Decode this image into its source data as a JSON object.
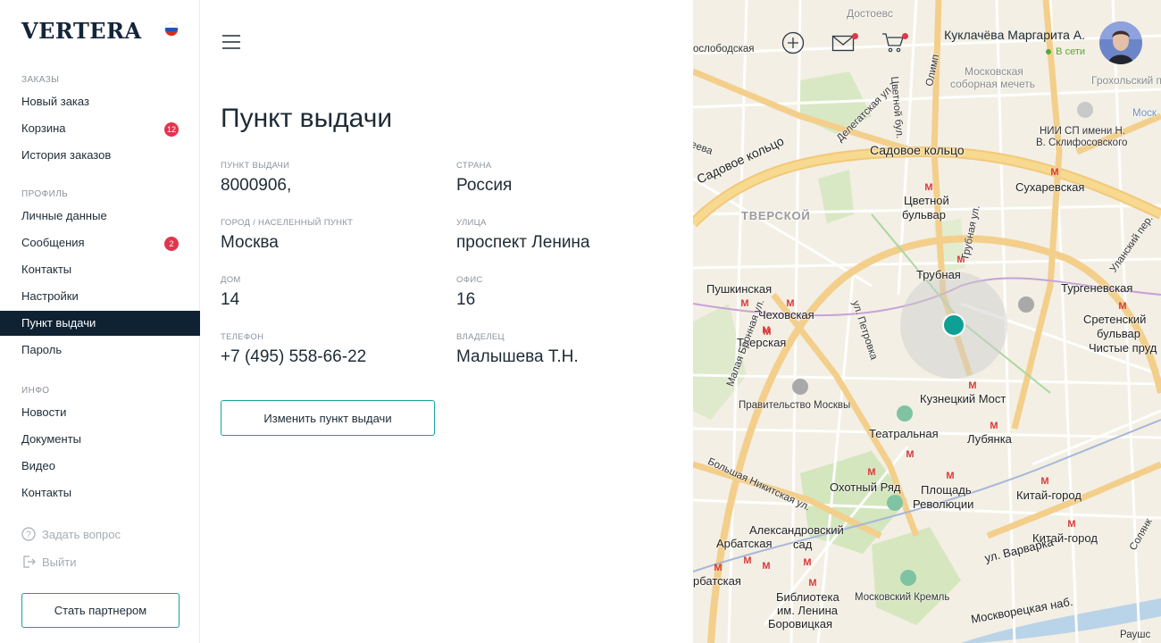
{
  "brand": {
    "logo": "VERTERA"
  },
  "sidebar": {
    "sections": [
      {
        "title": "ЗАКАЗЫ"
      },
      {
        "title": "ПРОФИЛЬ"
      },
      {
        "title": "ИНФО"
      }
    ],
    "items": [
      {
        "label": "Новый заказ"
      },
      {
        "label": "Корзина",
        "badge": "12"
      },
      {
        "label": "История заказов"
      },
      {
        "label": "Личные данные"
      },
      {
        "label": "Сообщения",
        "badge": "2"
      },
      {
        "label": "Контакты"
      },
      {
        "label": "Настройки"
      },
      {
        "label": "Пункт выдачи",
        "active": true
      },
      {
        "label": "Пароль"
      },
      {
        "label": "Новости"
      },
      {
        "label": "Документы"
      },
      {
        "label": "Видео"
      },
      {
        "label": "Контакты"
      }
    ],
    "ask_question": "Задать вопрос",
    "logout": "Выйти",
    "partner_button": "Стать партнером"
  },
  "main": {
    "title": "Пункт выдачи",
    "fields": [
      {
        "label": "ПУНКТ ВЫДАЧИ",
        "value": "8000906,"
      },
      {
        "label": "СТРАНА",
        "value": "Россия"
      },
      {
        "label": "ГОРОД / НАСЕЛЕННЫЙ ПУНКТ",
        "value": "Москва"
      },
      {
        "label": "УЛИЦА",
        "value": "проспект Ленина"
      },
      {
        "label": "ДОМ",
        "value": "14"
      },
      {
        "label": "ОФИС",
        "value": "16"
      },
      {
        "label": "ТЕЛЕФОН",
        "value": "+7 (495) 558-66-22"
      },
      {
        "label": "ВЛАДЕЛЕЦ",
        "value": "Малышева Т.Н."
      }
    ],
    "change_button": "Изменить пункт выдачи"
  },
  "header": {
    "user_name": "Куклачёва Маргарита А.",
    "user_status": "В сети",
    "icons": [
      "plus-circle-icon",
      "mail-icon",
      "cart-icon"
    ]
  },
  "map": {
    "labels": [
      "ослободская",
      "Достоевс",
      "Московская",
      "соборная мечеть",
      "Грохольский пер.",
      "Моск",
      "НИИ СП имени Н.",
      "В. Склифосовского",
      "Садовое кольцо",
      "Садовое кольцо",
      "Сухаревская",
      "Цветной",
      "бульвар",
      "ТВЕРСКОЙ",
      "Трубная",
      "Пушкинская",
      "Тургеневская",
      "Чеховская",
      "Сретенский",
      "бульвар",
      "Чистые пруд",
      "Тверская",
      "Кузнецкий Мост",
      "Правительство Москвы",
      "Театральная",
      "Лубянка",
      "Охотный Ряд",
      "Площадь",
      "Революции",
      "Китай-город",
      "Александровский",
      "сад",
      "Арбатская",
      "Китай-город",
      "ул. Варварка",
      "рбатская",
      "Библиотека",
      "им. Ленина",
      "Боровицкая",
      "Московский Кремль",
      "Москворецкая наб.",
      "ул. Петровка",
      "Трубная ул.",
      "Делегатская ул.",
      "Цветной бул.",
      "Большая Никитская ул.",
      "Малая Бронная ул.",
      "Уланский пер.",
      "Олимп",
      "еева",
      "Раушс",
      "Солянк"
    ]
  }
}
